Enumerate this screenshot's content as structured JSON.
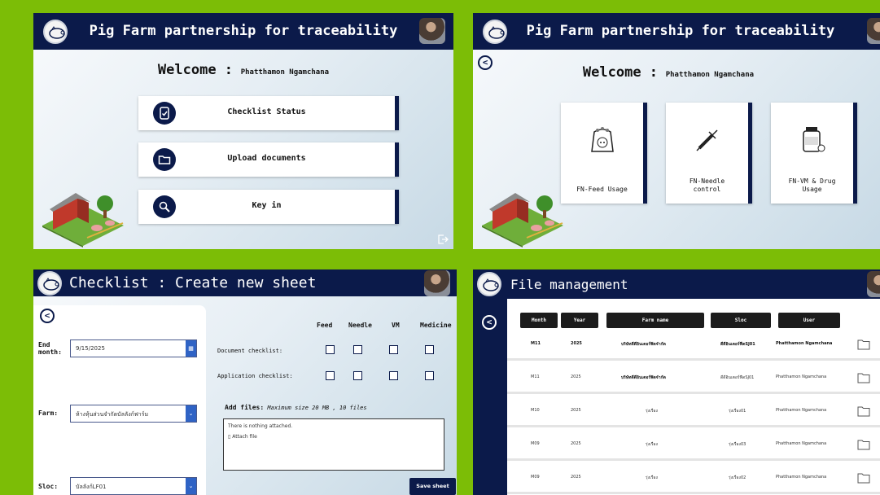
{
  "panel_home": {
    "title": "Pig Farm partnership for traceability",
    "welcome_label": "Welcome :",
    "user_name": "Phatthamon Ngamchana",
    "menu": [
      {
        "label": "Checklist Status",
        "icon": "checklist-icon"
      },
      {
        "label": "Upload documents",
        "icon": "folder-icon"
      },
      {
        "label": "Key in",
        "icon": "search-icon"
      }
    ]
  },
  "panel_keyin": {
    "title": "Pig Farm partnership for traceability",
    "welcome_label": "Welcome :",
    "user_name": "Phatthamon Ngamchana",
    "cards": [
      {
        "label1": "FN-Feed Usage",
        "label2": "",
        "icon": "feed-sack-icon"
      },
      {
        "label1": "FN-Needle",
        "label2": "control",
        "icon": "syringe-icon"
      },
      {
        "label1": "FN-VM & Drug",
        "label2": "Usage",
        "icon": "medicine-icon"
      }
    ]
  },
  "panel_checklist": {
    "title": "Checklist : Create new sheet",
    "end_month_label1": "End",
    "end_month_label2": "month:",
    "end_month_value": "9/15/2025",
    "farm_label": "Farm:",
    "farm_value": "ห้างหุ้นส่วนจำกัดบัลลังก์ฟาร์ม",
    "sloc_label": "Sloc:",
    "sloc_value": "บัลลังก์LF01",
    "columns": [
      "Feed",
      "Needle",
      "VM",
      "Medicine"
    ],
    "rows": [
      "Document checklist:",
      "Application checklist:"
    ],
    "add_files_label": "Add files:",
    "add_files_note": "Maximum size 20 MB , 10 files",
    "attach_empty": "There is nothing attached.",
    "attach_link": "Attach file",
    "save_label": "Save sheet"
  },
  "panel_files": {
    "title": "File management",
    "headers": [
      "Month",
      "Year",
      "Farm name",
      "Sloc",
      "User"
    ],
    "rows": [
      {
        "month": "M11",
        "year": "2025",
        "farm": "บริษัทดีดีอินเตอร์ฟิดจำกัด",
        "sloc": "ดีดีอินเตอร์ฟีดSJ01",
        "user": "Phatthamon Ngamchana",
        "bold": true
      },
      {
        "month": "M11",
        "year": "2025",
        "farm": "บริษัทดีดีอินเตอร์ฟิดจำกัด",
        "sloc": "ดีดีอินเตอร์ฟีดSJ01",
        "user": "Phatthamon Ngamchana",
        "bold": false
      },
      {
        "month": "M10",
        "year": "2025",
        "farm": "รุ่งเรือง",
        "sloc": "รุ่งเรือง01",
        "user": "Phatthamon Ngamchana",
        "bold": false
      },
      {
        "month": "M09",
        "year": "2025",
        "farm": "รุ่งเรือง",
        "sloc": "รุ่งเรือง03",
        "user": "Phatthamon Ngamchana",
        "bold": false
      },
      {
        "month": "M09",
        "year": "2025",
        "farm": "รุ่งเรือง",
        "sloc": "รุ่งเรือง02",
        "user": "Phatthamon Ngamchana",
        "bold": false
      }
    ]
  },
  "colors": {
    "navy": "#0b1a4a",
    "green_bg": "#7cbd06",
    "blue_button": "#2f63c5"
  }
}
